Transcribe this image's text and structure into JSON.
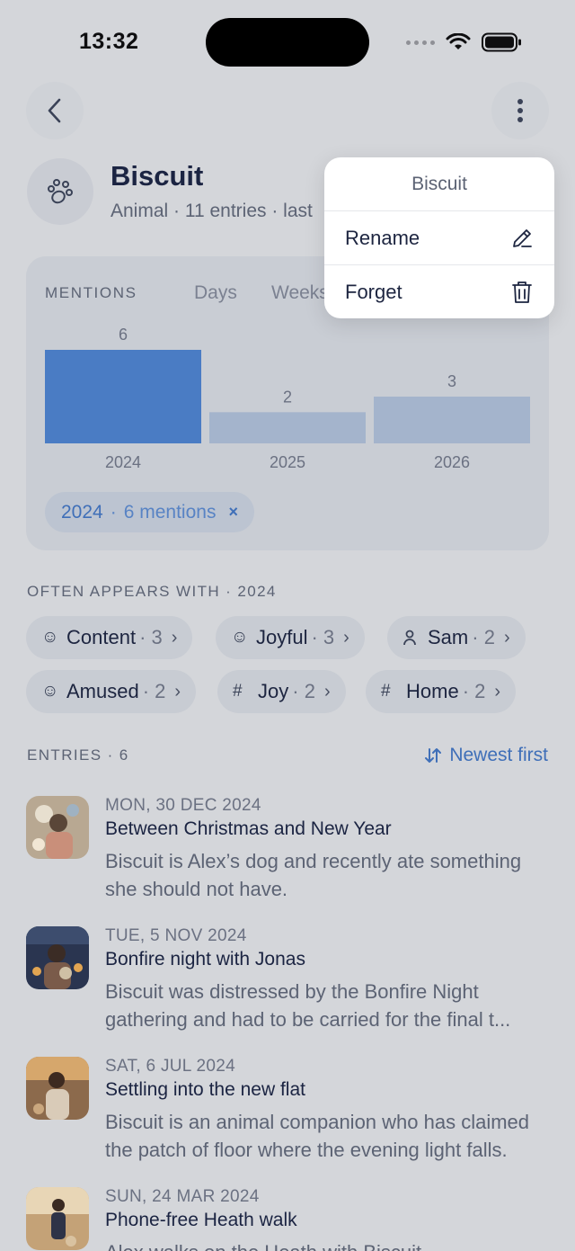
{
  "status": {
    "time": "13:32"
  },
  "entity": {
    "name": "Biscuit",
    "subtitle": "Animal · 11 entries · last"
  },
  "menu": {
    "title": "Biscuit",
    "items": [
      {
        "label": "Rename",
        "icon": "pencil-icon"
      },
      {
        "label": "Forget",
        "icon": "trash-icon"
      }
    ]
  },
  "mentions": {
    "label": "MENTIONS",
    "tabs": [
      "Days",
      "Weeks"
    ],
    "filter": {
      "year": "2024",
      "sep": "·",
      "text": "6 mentions",
      "clear": "×"
    }
  },
  "chart_data": {
    "type": "bar",
    "categories": [
      "2024",
      "2025",
      "2026"
    ],
    "values": [
      6,
      2,
      3
    ],
    "selected": "2024",
    "colors": {
      "selected": "#4a7cc4",
      "default": "#a4b4cc"
    }
  },
  "often": {
    "label": "OFTEN APPEARS WITH · 2024",
    "tags": [
      {
        "label": "Content",
        "count": "· 3",
        "icon": "smile-icon"
      },
      {
        "label": "Joyful",
        "count": "· 3",
        "icon": "smile-icon"
      },
      {
        "label": "Sam",
        "count": "· 2",
        "icon": "person-icon"
      },
      {
        "label": "Amused",
        "count": "· 2",
        "icon": "smile-icon"
      },
      {
        "label": "Joy",
        "count": "· 2",
        "icon": "hash-icon"
      },
      {
        "label": "Home",
        "count": "· 2",
        "icon": "hash-icon"
      }
    ]
  },
  "entries": {
    "label": "ENTRIES · 6",
    "sort": "Newest first",
    "items": [
      {
        "date": "MON, 30 DEC 2024",
        "title": "Between Christmas and New Year",
        "text": "Biscuit is Alex’s dog and recently ate something she should not have."
      },
      {
        "date": "TUE, 5 NOV 2024",
        "title": "Bonfire night with Jonas",
        "text": "Biscuit was distressed by the Bonfire Night gathering and had to be carried for the final t..."
      },
      {
        "date": "SAT, 6 JUL 2024",
        "title": "Settling into the new flat",
        "text": "Biscuit is an animal companion who has claimed the patch of floor where the evening light falls."
      },
      {
        "date": "SUN, 24 MAR 2024",
        "title": "Phone-free Heath walk",
        "text": "Alex walks on the Heath with Biscuit"
      }
    ]
  }
}
